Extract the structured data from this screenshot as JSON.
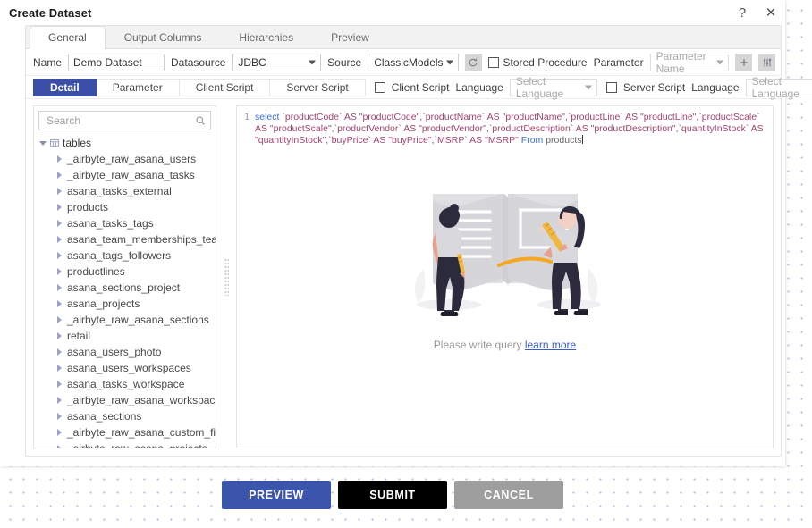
{
  "window": {
    "title": "Create Dataset",
    "help_icon": "help-question-icon",
    "close_icon": "close-icon",
    "help_label": "?",
    "close_label": "✕"
  },
  "tabs": [
    {
      "label": "General",
      "active": true
    },
    {
      "label": "Output Columns",
      "active": false
    },
    {
      "label": "Hierarchies",
      "active": false
    },
    {
      "label": "Preview",
      "active": false
    }
  ],
  "meta_row": {
    "name_label": "Name",
    "name_value": "Demo Dataset",
    "name_placeholder": "",
    "datasource_label": "Datasource",
    "datasource_value": "JDBC",
    "source_label": "Source",
    "source_value": "ClassicModels",
    "refresh_icon": "refresh-icon",
    "stored_procedure_label": "Stored Procedure",
    "stored_procedure_checked": false,
    "parameter_label": "Parameter",
    "parameter_placeholder": "Parameter Name",
    "add_icon": "plus-icon",
    "settings_icon": "sliders-icon"
  },
  "subtabs": [
    {
      "label": "Detail",
      "active": true
    },
    {
      "label": "Parameter",
      "active": false
    },
    {
      "label": "Client Script",
      "active": false
    },
    {
      "label": "Server Script",
      "active": false
    }
  ],
  "script_options": {
    "client_script_label": "Client Script",
    "client_script_checked": false,
    "client_language_label": "Language",
    "client_language_placeholder": "Select Language",
    "server_script_label": "Server Script",
    "server_script_checked": false,
    "server_language_label": "Language",
    "server_language_placeholder": "Select Language"
  },
  "tree": {
    "search_placeholder": "Search",
    "search_value": "",
    "search_icon": "search-icon",
    "root_label": "tables",
    "root_icon": "database-icon",
    "root_expanded": true,
    "items": [
      "_airbyte_raw_asana_users",
      "_airbyte_raw_asana_tasks",
      "asana_tasks_external",
      "products",
      "asana_tasks_tags",
      "asana_team_memberships_team",
      "asana_tags_followers",
      "productlines",
      "asana_sections_project",
      "asana_projects",
      "_airbyte_raw_asana_sections",
      "retail",
      "asana_users_photo",
      "asana_users_workspaces",
      "asana_tasks_workspace",
      "_airbyte_raw_asana_workspaces",
      "asana_sections",
      "_airbyte_raw_asana_custom_fields",
      "_airbyte_raw_asana_projects"
    ]
  },
  "editor": {
    "line_number": "1",
    "query_tokens": [
      {
        "t": "select ",
        "c": "kw"
      },
      {
        "t": "`productCode` AS \"productCode\",`productName` AS \"productName\",`productLine` AS \"productLine\",`productScale` AS \"productScale\",`productVendor` AS \"productVendor\",`productDescription` AS \"productDescription\",`quantityInStock` AS \"quantityInStock\",`buyPrice` AS \"buyPrice\",`MSRP` AS \"MSRP\" ",
        "c": "str"
      },
      {
        "t": "From ",
        "c": "kw"
      },
      {
        "t": "products",
        "c": "ident"
      }
    ],
    "query_plain": "select `productCode` AS \"productCode\",`productName` AS \"productName\",`productLine` AS \"productLine\",`productScale` AS \"productScale\",`productVendor` AS \"productVendor\",`productDescription` AS \"productDescription\",`quantityInStock` AS \"quantityInStock\",`buyPrice` AS \"buyPrice\",`MSRP` AS \"MSRP\" From products",
    "hint_text": "Please write query",
    "hint_link": "learn more",
    "illustration": "two-people-writing-in-book-illustration"
  },
  "footer": {
    "preview_label": "PREVIEW",
    "submit_label": "SUBMIT",
    "cancel_label": "CANCEL"
  },
  "colors": {
    "accent_blue": "#3b55ad",
    "active_subtab": "#3b4ea8",
    "submit_black": "#000000",
    "cancel_gray": "#9e9e9e",
    "link_blue": "#3b5bd0",
    "sql_string": "#a0446e",
    "sql_keyword": "#3b6fd4",
    "dot_pattern": "#b9b6e8"
  }
}
